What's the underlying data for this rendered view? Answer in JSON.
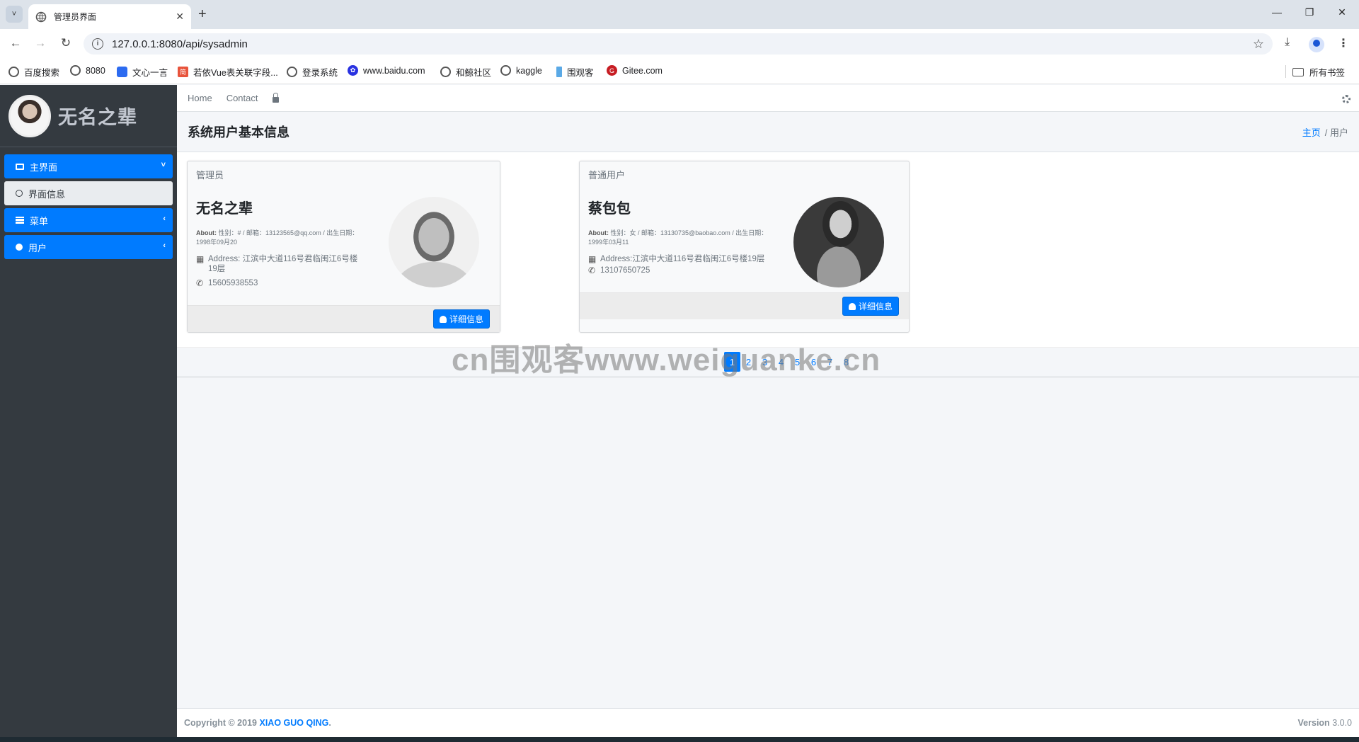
{
  "browser": {
    "tab_title": "管理员界面",
    "url": "127.0.0.1:8080/api/sysadmin",
    "bookmarks": [
      {
        "label": "百度搜索",
        "icon": "globe-icon"
      },
      {
        "label": "8080",
        "icon": "globe-icon"
      },
      {
        "label": "文心一言",
        "icon": "wenxin-icon"
      },
      {
        "label": "若依Vue表关联字段...",
        "icon": "jianshu-icon"
      },
      {
        "label": "登录系统",
        "icon": "globe-icon"
      },
      {
        "label": "www.baidu.com",
        "icon": "baidu-paw-icon"
      },
      {
        "label": "和鲸社区",
        "icon": "globe-icon"
      },
      {
        "label": "kaggle",
        "icon": "globe-icon"
      },
      {
        "label": "围观客",
        "icon": "flag-icon"
      },
      {
        "label": "Gitee.com",
        "icon": "gitee-icon"
      }
    ],
    "all_bookmarks_label": "所有书签"
  },
  "sidebar": {
    "brand": "无名之辈",
    "items": [
      {
        "label": "主界面",
        "icon": "desktop-icon",
        "caret": "˅"
      },
      {
        "label": "界面信息",
        "icon": "circle-icon"
      },
      {
        "label": "菜单",
        "icon": "grid-icon",
        "caret": "‹"
      },
      {
        "label": "用户",
        "icon": "user-circle-icon",
        "caret": "‹"
      }
    ]
  },
  "topnav": {
    "home": "Home",
    "contact": "Contact"
  },
  "header": {
    "title": "系统用户基本信息",
    "breadcrumb_home": "主页",
    "breadcrumb_current": "/ 用户"
  },
  "cards": [
    {
      "role": "管理员",
      "name": "无名之辈",
      "about_label": "About:",
      "about_text": "性别：# / 邮箱：13123565@qq.com / 出生日期：1998年09月20",
      "address": "Address: 江滨中大道116号君临闽江6号楼19层",
      "phone": "15605938553",
      "button": "详细信息"
    },
    {
      "role": "普通用户",
      "name": "蔡包包",
      "about_label": "About:",
      "about_text": "性别：女 / 邮箱：13130735@baobao.com / 出生日期：1999年03月11",
      "address": "Address:江滨中大道116号君临闽江6号楼19层",
      "phone": "13107650725",
      "button": "详细信息"
    }
  ],
  "pagination": [
    "1",
    "2",
    "3",
    "4",
    "5",
    "6",
    "7",
    "8"
  ],
  "watermark": "cn围观客www.weiguanke.cn",
  "footer": {
    "copyright": "Copyright © 2019",
    "author": "XIAO GUO QING",
    "period": ".",
    "version_label": "Version",
    "version": "3.0.0"
  },
  "colors": {
    "primary": "#007bff",
    "sidebar": "#343a40"
  }
}
